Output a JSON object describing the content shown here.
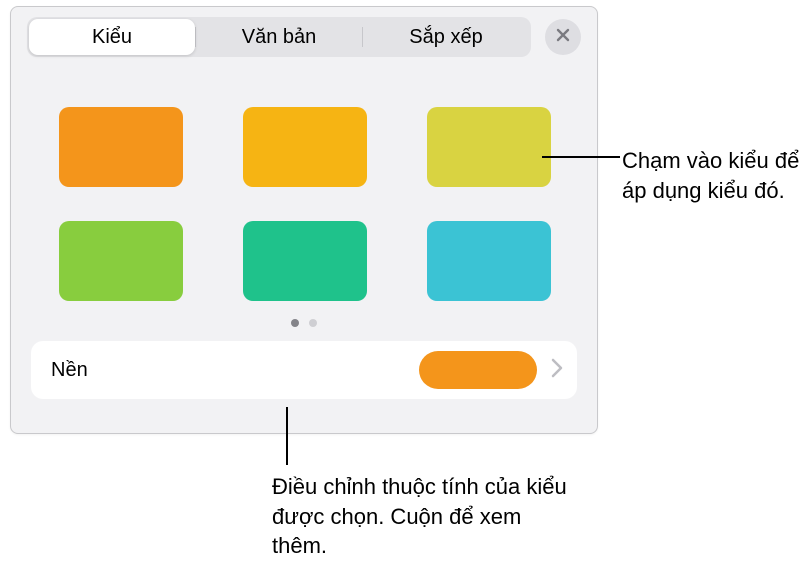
{
  "tabs": {
    "style": "Kiểu",
    "text": "Văn bản",
    "arrange": "Sắp xếp"
  },
  "swatches": [
    {
      "name": "orange"
    },
    {
      "name": "amber"
    },
    {
      "name": "olive"
    },
    {
      "name": "green"
    },
    {
      "name": "teal"
    },
    {
      "name": "cyan"
    }
  ],
  "row": {
    "fill_label": "Nền"
  },
  "callouts": {
    "tap_style": "Chạm vào kiểu để áp dụng kiểu đó.",
    "adjust": "Điều chỉnh thuộc tính của kiểu được chọn. Cuộn để xem thêm."
  }
}
